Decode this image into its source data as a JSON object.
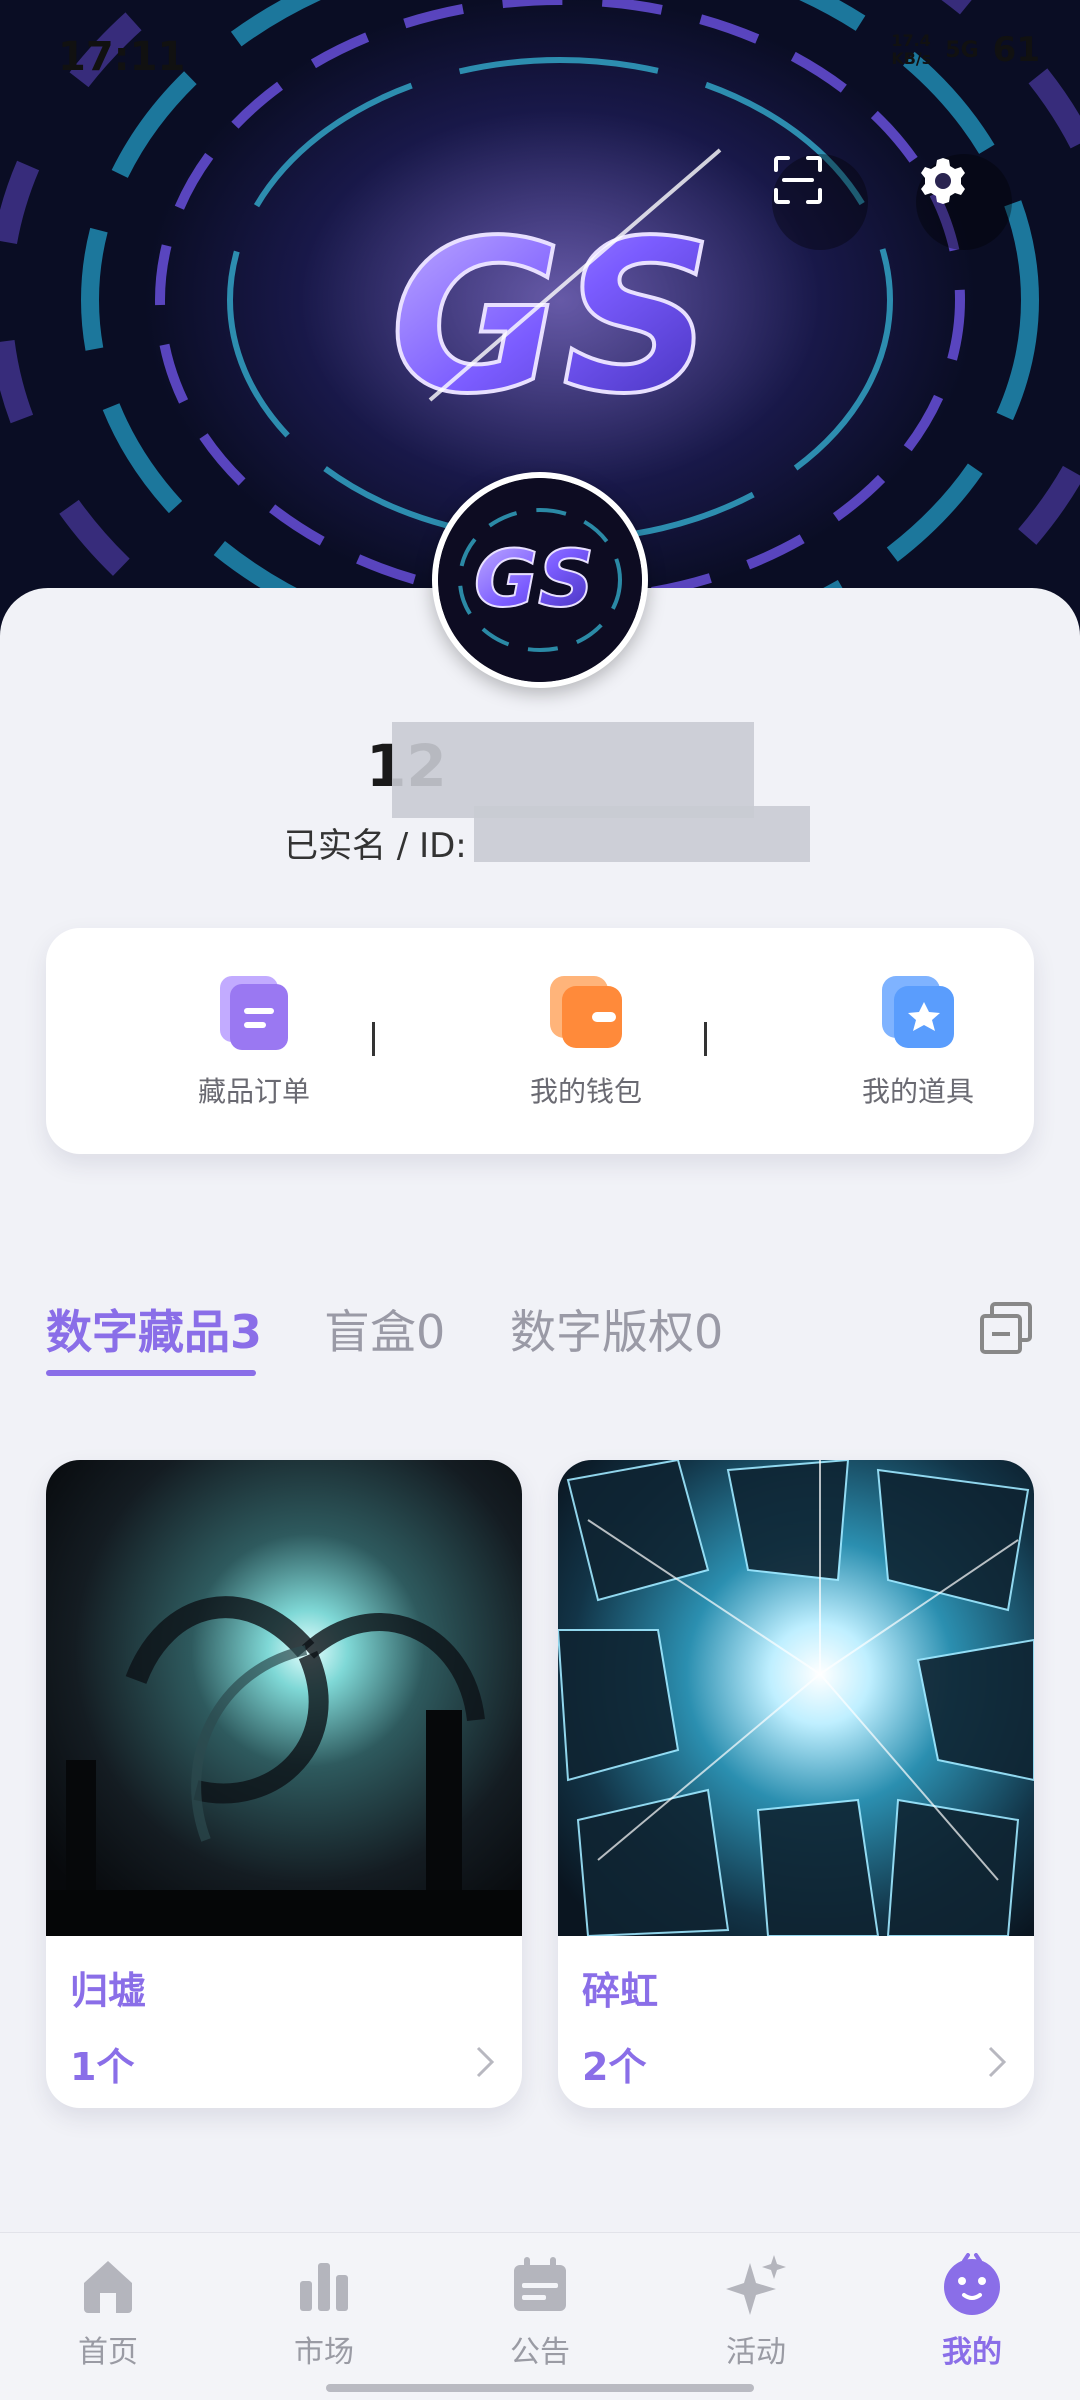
{
  "status_bar": {
    "time": "17:11",
    "net_speed": "17.4",
    "net_unit": "KB/s",
    "signal_label": "5G",
    "battery": "61"
  },
  "hero": {
    "logo_text": "GS",
    "scan_icon": "scan-icon",
    "settings_icon": "gear-icon"
  },
  "profile": {
    "avatar_text": "GS",
    "username_visible": "12",
    "verify_prefix": "已实名 / ID:"
  },
  "actions": [
    {
      "label": "藏品订单",
      "icon": "document-icon",
      "color": "#a98bf5"
    },
    {
      "label": "我的钱包",
      "icon": "wallet-icon",
      "color": "#ff9a4a"
    },
    {
      "label": "我的道具",
      "icon": "star-card-icon",
      "color": "#5a9dfd"
    }
  ],
  "tabs": [
    {
      "label": "数字藏品3",
      "active": true
    },
    {
      "label": "盲盒0",
      "active": false
    },
    {
      "label": "数字版权0",
      "active": false
    }
  ],
  "collection": [
    {
      "title": "归墟",
      "count": "1个",
      "image": "galaxy-vortex-image"
    },
    {
      "title": "碎虹",
      "count": "2个",
      "image": "shattered-glass-image"
    }
  ],
  "bottom_nav": [
    {
      "label": "首页",
      "icon": "home-icon",
      "active": false
    },
    {
      "label": "市场",
      "icon": "bar-chart-icon",
      "active": false
    },
    {
      "label": "公告",
      "icon": "calendar-icon",
      "active": false
    },
    {
      "label": "活动",
      "icon": "sparkle-icon",
      "active": false
    },
    {
      "label": "我的",
      "icon": "smiley-icon",
      "active": true
    }
  ],
  "colors": {
    "accent": "#8a6ee8",
    "inactive": "#9a9ba4",
    "background": "#f1f2f7"
  }
}
